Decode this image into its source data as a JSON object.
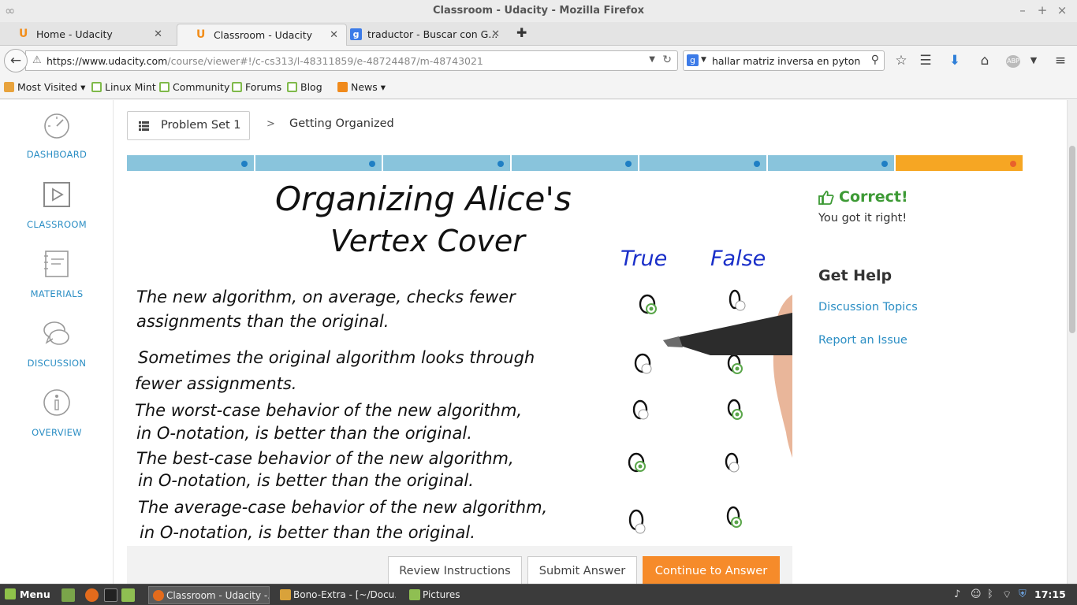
{
  "window": {
    "title": "Classroom - Udacity - Mozilla Firefox"
  },
  "tabs": [
    {
      "label": "Home - Udacity",
      "icon": "udacity-icon"
    },
    {
      "label": "Classroom - Udacity",
      "icon": "udacity-icon",
      "active": true
    },
    {
      "label": "traductor - Buscar con G...",
      "icon": "google-icon"
    }
  ],
  "nav": {
    "url_host": "https://www.udacity.com",
    "url_path": "/course/viewer#!/c-cs313/l-48311859/e-48724487/m-48743021",
    "search_query": "hallar matriz inversa en pyton",
    "search_engine_letter": "g",
    "abp_label": "ABP"
  },
  "bookmarks": [
    {
      "label": "Most Visited",
      "icon": "folder-icon",
      "dropdown": true
    },
    {
      "label": "Linux Mint",
      "icon": "mint-icon"
    },
    {
      "label": "Community",
      "icon": "mint-icon"
    },
    {
      "label": "Forums",
      "icon": "mint-icon"
    },
    {
      "label": "Blog",
      "icon": "mint-icon"
    },
    {
      "label": "News",
      "icon": "rss-icon",
      "dropdown": true
    }
  ],
  "sidebar": {
    "items": [
      {
        "label": "DASHBOARD",
        "icon": "speedometer-icon"
      },
      {
        "label": "CLASSROOM",
        "icon": "play-icon"
      },
      {
        "label": "MATERIALS",
        "icon": "notebook-icon"
      },
      {
        "label": "DISCUSSION",
        "icon": "chat-bubbles-icon"
      },
      {
        "label": "OVERVIEW",
        "icon": "info-icon"
      }
    ]
  },
  "breadcrumb": {
    "lesson": "Problem Set 1",
    "separator": ">",
    "current": "Getting Organized"
  },
  "progress": {
    "segments": 7,
    "current_index": 6
  },
  "quiz": {
    "title_line1": "Organizing  Alice's",
    "title_line2": "Vertex  Cover",
    "true_label": "True",
    "false_label": "False",
    "statements": [
      "The new algorithm, on average, checks fewer",
      "assignments than the original.",
      "Sometimes the original algorithm looks through",
      "fewer assignments.",
      "The worst-case behavior of the new algorithm,",
      "in O-notation, is better than the original.",
      "The best-case behavior of the new algorithm,",
      "in O-notation, is better than the original.",
      "The average-case behavior of the new algorithm,",
      "in O-notation, is better than the original."
    ]
  },
  "feedback": {
    "status": "Correct!",
    "message": "You got it right!",
    "status_color": "#3d9a35"
  },
  "help": {
    "heading": "Get Help",
    "links": [
      "Discussion Topics",
      "Report an Issue"
    ]
  },
  "actions": {
    "review": "Review Instructions",
    "submit": "Submit Answer",
    "continue": "Continue to Answer",
    "accent": "#f68b2a"
  },
  "taskbar": {
    "menu_label": "Menu",
    "tasks": [
      {
        "label": "Classroom - Udacity -...",
        "active": true
      },
      {
        "label": "Bono-Extra - [~/Docu..."
      },
      {
        "label": "Pictures"
      }
    ],
    "clock": "17:15"
  }
}
